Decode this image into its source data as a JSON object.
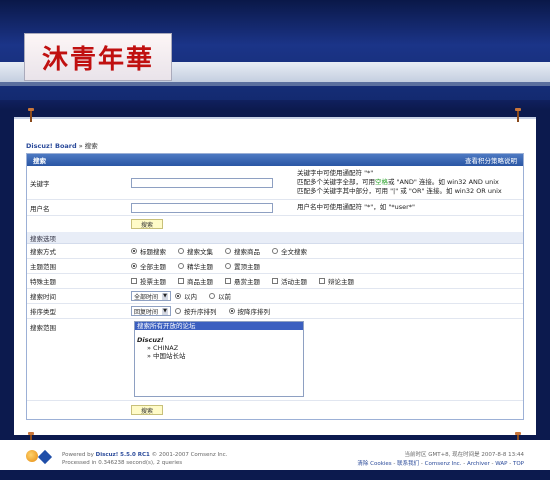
{
  "logo_text": "沐青年華",
  "nav": [
    "",
    "",
    "",
    "",
    "",
    "",
    "",
    ""
  ],
  "breadcrumb": {
    "home": "Discuz! Board",
    "sep": "»",
    "current": "搜索"
  },
  "panel": {
    "title": "搜索",
    "help_link": "查看积分策略说明",
    "keyword_label": "关键字",
    "keyword_value": "",
    "keyword_hint_1": "关键字中可使用通配符 \"*\"",
    "keyword_hint_2a": "匹配多个关键字全部，可用",
    "keyword_hint_2b": "空格",
    "keyword_hint_2c": "或 \"AND\" 连接。如 win32 AND unix",
    "keyword_hint_3a": "匹配多个关键字其中部分，可用 \"|\" 或 \"OR\" 连接。如 win32 OR unix",
    "user_label": "用户名",
    "user_value": "",
    "user_hint": "用户名中可使用通配符 \"*\"，如 \"*user*\"",
    "search_button": "搜索",
    "options_title": "搜索选项",
    "mode_label": "搜索方式",
    "mode_options": [
      "标题搜索",
      "搜索文集",
      "搜索商品",
      "全文搜索"
    ],
    "mode_selected": 0,
    "range_label": "主题范围",
    "range_options": [
      "全部主题",
      "精华主题",
      "置顶主题"
    ],
    "special_label": "特殊主题",
    "special_options": [
      "投票主题",
      "商品主题",
      "悬赏主题",
      "活动主题",
      "辩论主题"
    ],
    "time_label": "搜索时间",
    "time_select": "全部时间",
    "time_options": [
      "以内",
      "以前"
    ],
    "order_label": "排序类型",
    "order_select": "回复时间",
    "order_options": [
      "按升序排列",
      "按降序排列"
    ],
    "forum_label": "搜索范围",
    "forum_list": {
      "selected": "搜索所有开放的论坛",
      "group": "Discuz!",
      "items": [
        "» CHINAZ",
        "» 中国站长站"
      ]
    }
  },
  "footer": {
    "powered": "Powered by",
    "product": "Discuz! 5.5.0 RC1",
    "copyright": "© 2001-2007 Comsenz Inc.",
    "processed": "Processed in 0.346238 second(s), 2 queries",
    "timezone": "当前时区 GMT+8, 现在时间是 2007-8-8 13:44",
    "links": [
      "清除 Cookies",
      "联系我们",
      "Comsenz Inc.",
      "Archiver",
      "WAP",
      "TOP"
    ]
  },
  "colors": {
    "header": "#2a56a4",
    "accent_green": "#2aa12a",
    "link": "#2a4a9a"
  }
}
